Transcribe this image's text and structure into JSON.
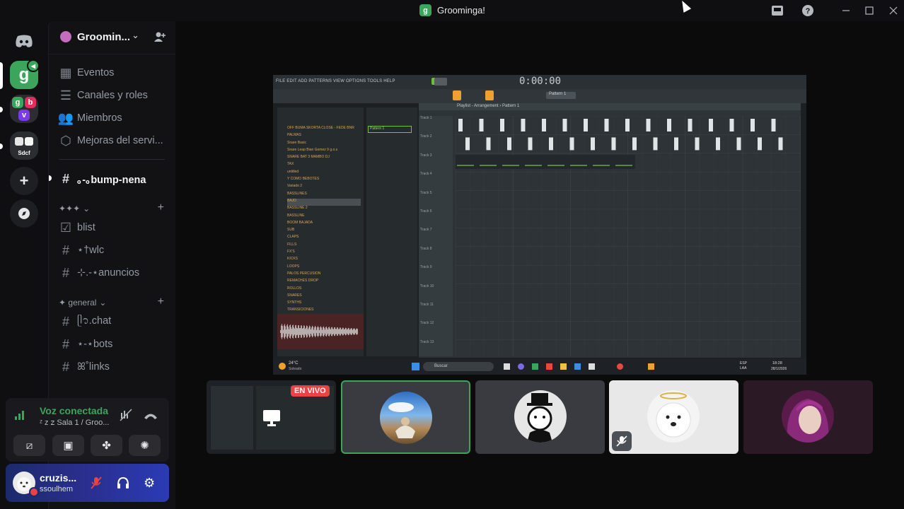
{
  "window": {
    "title": "Groominga!",
    "logo_letter": "g",
    "icons": [
      "inbox-icon",
      "help-icon",
      "minimize-icon",
      "maximize-icon",
      "close-icon"
    ]
  },
  "guilds": {
    "items": [
      "discord-home",
      "groominga-server",
      "folder-servers",
      "sdcf-server",
      "add-server",
      "explore-servers"
    ],
    "sdcf_label": "Sdcf"
  },
  "server": {
    "name": "Groomin...",
    "nav": [
      {
        "label": "Eventos",
        "icon": "calendar-icon"
      },
      {
        "label": "Canales y roles",
        "icon": "list-icon"
      },
      {
        "label": "Miembros",
        "icon": "members-icon"
      },
      {
        "label": "Mejoras del servi...",
        "icon": "boost-icon"
      }
    ],
    "selected_channel": "｡-｡bump-nena",
    "categories": [
      {
        "name": "✦✦✦",
        "channels": [
          {
            "icon": "checklist-icon",
            "name": "blist"
          },
          {
            "icon": "#",
            "name": "⋆†wlc"
          },
          {
            "icon": "#",
            "name": "⊹.-⋆anuncios"
          }
        ]
      },
      {
        "name": "✦ general",
        "channels": [
          {
            "icon": "#",
            "name": "ᥫ᭡.chat"
          },
          {
            "icon": "#",
            "name": "⋆-⋆bots"
          },
          {
            "icon": "#",
            "name": "ꕤ˚links"
          }
        ]
      }
    ]
  },
  "voice": {
    "status": "Voz conectada",
    "channel": "ᶻ z 𝗓 Sala 1 / Groo..."
  },
  "user": {
    "name": "cruzis...",
    "handle": "ssoulhem"
  },
  "stream": {
    "menu": "FILE EDIT ADD PATTERNS VIEW OPTIONS TOOLS HELP",
    "time": "0:00:00",
    "playlist_title": "Playlist - Arrangement › Pattern 1",
    "pattern_label": "Pattern 1",
    "browser_items": [
      "OFF BUMA SKORTA CLOSE - FEDE BNR",
      "PALMAS",
      "Snare Basic",
      "Snare Leap Bian Gomez 9 g.o.s",
      "SNARE BAT 3 MAMBO DJ",
      "TAX",
      "untitled",
      "Y COMO BEBOTES",
      "Variado 2",
      "BASSLINES",
      "BAJO",
      "BASSLINE 2",
      "BASSLINE",
      "BOOM BAJADA",
      "SUB",
      "CLAPS",
      "FILLS",
      "FX'S",
      "KICKS",
      "LOOPS",
      "PALOS PERCUSION",
      "REMACHES DROP",
      "ROLLOS",
      "SNARES",
      "SYNTHS",
      "TRANSICIONES"
    ],
    "tracks": [
      "Track 1",
      "Track 2",
      "Track 3",
      "Track 4",
      "Track 5",
      "Track 6",
      "Track 7",
      "Track 8",
      "Track 9",
      "Track 10",
      "Track 11",
      "Track 12",
      "Track 13"
    ],
    "taskbar_search": "Buscar",
    "weather_temp": "24°C",
    "weather_desc": "Soleado",
    "lang": "ESP\nLAA",
    "clock_time": "18:28",
    "clock_date": "28/1/2026"
  },
  "tiles": [
    {
      "type": "stream-preview",
      "badge": "EN VIVO"
    },
    {
      "type": "avatar",
      "speaking": true
    },
    {
      "type": "avatar"
    },
    {
      "type": "avatar",
      "muted": true
    },
    {
      "type": "avatar"
    }
  ],
  "colors": {
    "accent_green": "#3ba55c",
    "live_red": "#ed4245",
    "fl_orange": "#f0a030"
  }
}
